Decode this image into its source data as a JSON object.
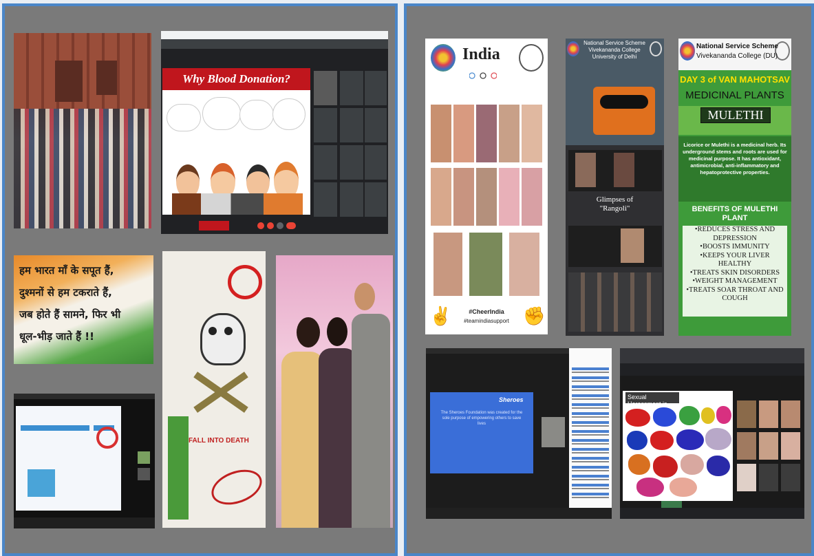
{
  "collage_left": {
    "blood_slide": {
      "title_prefix": "Why",
      "title_main": "Blood Donation?"
    },
    "hindi_poem": {
      "line1": "हम भारत माँ के सपूत हैं,",
      "line2": "दुश्मनों से हम टकराते हैं,",
      "line3": "जब होते हैं सामने, फिर भी",
      "line4": "धूल-भीड़ जाते हैं !!"
    },
    "poster": {
      "falling": "FALL",
      "into": "INTO",
      "death": "DEATH"
    }
  },
  "collage_right": {
    "olympics_poster": {
      "title": "India",
      "hashtag1": "#CheerIndia",
      "hashtag2": "#teamindiasupport"
    },
    "rangoli_poster": {
      "header1": "National Service Scheme",
      "header2": "Vivekananda College",
      "header3": "University of Delhi",
      "caption1": "Glimpses of",
      "caption2": "\"Rangoli\""
    },
    "mulethi_poster": {
      "org": "National Service Scheme",
      "college": "Vivekananda College (DU)",
      "day": "DAY 3 of VAN MAHOTSAV",
      "topic": "MEDICINAL PLANTS",
      "plant": "MULETHI",
      "description": "Licorice or Mulethi is a medicinal herb. Its underground stems and roots are used for medicinal purpose. It has antioxidant, antimicrobial, anti-inflammatory and hepatoprotective properties.",
      "benefits_title": "BENEFITS OF MULETHI PLANT",
      "benefits": [
        "•REDUCES STRESS AND DEPRESSION",
        "•BOOSTS IMMUNITY",
        "•KEEPS YOUR LIVER HEALTHY",
        "•TREATS SKIN DISORDERS",
        "•WEIGHT MANAGEMENT",
        "•TREATS SOAR THROAT AND COUGH"
      ]
    },
    "sheroes_slide": {
      "brand": "Sheroes",
      "body": "The Sheroes Foundation was created for the sole purpose of empowering others to save lives"
    },
    "harassment_slide": {
      "title": "Sexual Harassment is..."
    }
  },
  "colors": {
    "panel_bg": "#7a7a7a",
    "panel_border": "#4a86c8",
    "blood_red": "#c0161d",
    "mulethi_green": "#3e9b3a",
    "mulethi_title_red": "#b00000"
  }
}
